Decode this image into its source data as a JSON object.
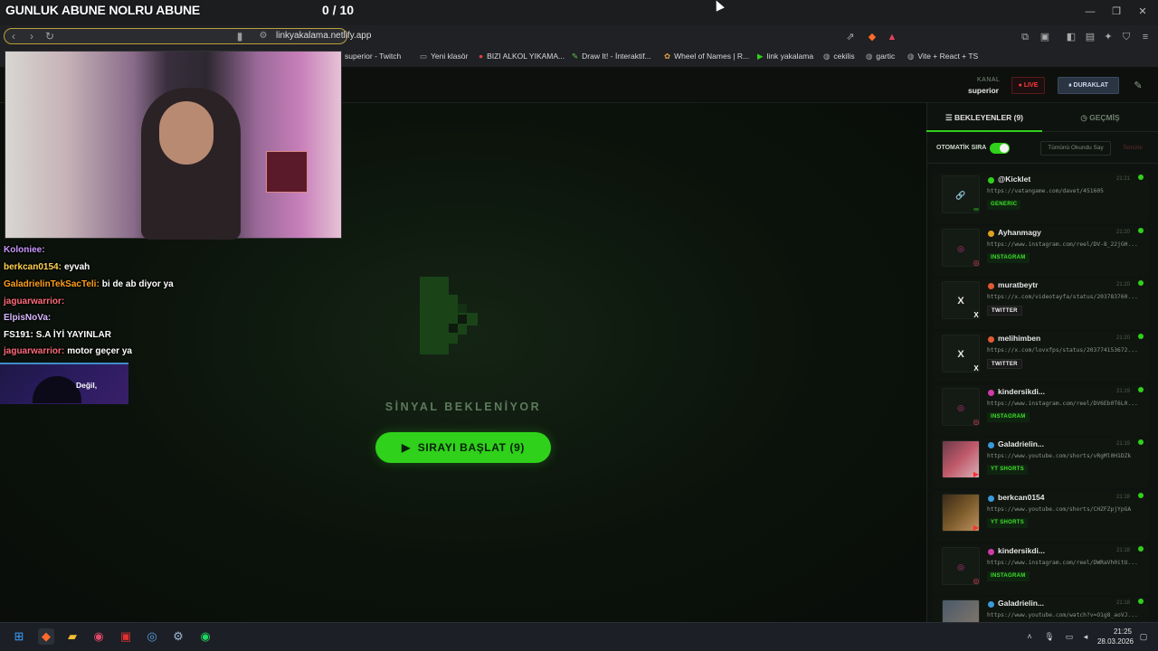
{
  "stream_overlay": {
    "title": "GUNLUK ABUNE NOLRU ABUNE",
    "counter": "0 / 10"
  },
  "browser": {
    "url": "linkyakalama.netlify.app",
    "bookmarks": [
      {
        "label": "superior - Twitch",
        "icon": "twitch-icon"
      },
      {
        "label": "Yeni klasör",
        "icon": "folder-icon"
      },
      {
        "label": "BIZI ALKOL YIKAMA...",
        "icon": "bookmark-icon"
      },
      {
        "label": "Draw It! - İnteraktif...",
        "icon": "draw-icon"
      },
      {
        "label": "Wheel of Names | R...",
        "icon": "wheel-icon"
      },
      {
        "label": "link yakalama",
        "icon": "play-icon"
      },
      {
        "label": "cekilis",
        "icon": "globe-icon"
      },
      {
        "label": "gartic",
        "icon": "globe-icon"
      },
      {
        "label": "Vite + React + TS",
        "icon": "globe-icon"
      }
    ]
  },
  "header": {
    "kanal_label": "KANAL",
    "kanal_name": "superior",
    "live_label": "LIVE",
    "pause_label": "DURAKLAT"
  },
  "main": {
    "status": "SİNYAL BEKLENİYOR",
    "start_button": "SIRAYI BAŞLAT (9)"
  },
  "chat": [
    {
      "user": "Koloniee:",
      "color": "#c995ff",
      "msg": ""
    },
    {
      "user": "berkcan0154:",
      "color": "#ffd34d",
      "msg": "eyvah"
    },
    {
      "user": "GaladrielinTekSacTeli:",
      "color": "#ff9f1c",
      "msg": "bi de ab diyor ya"
    },
    {
      "user": "jaguarwarrior:",
      "color": "#ff6a7a",
      "msg": ""
    },
    {
      "user": "ElpisNoVa:",
      "color": "#d9b8ff",
      "msg": ""
    },
    {
      "user": "FS191:",
      "color": "#ffffff",
      "msg": "S.A İYİ YAYINLAR"
    },
    {
      "user": "jaguarwarrior:",
      "color": "#ff6a7a",
      "msg": "motor geçer ya"
    }
  ],
  "chat_notification": "Değil,",
  "sidebar": {
    "tab_queue": "BEKLEYENLER (9)",
    "tab_history": "GEÇMİŞ",
    "auto_label": "OTOMATİK SIRA",
    "mark_all": "Tümünü Okundu Say",
    "clear": "Temizle",
    "items": [
      {
        "name": "@Kicklet",
        "time": "21:21",
        "url": "https://vatangame.com/davet/451605",
        "tag": "GENERIC",
        "src_color": "#2fd11a",
        "thumb": "link-icon"
      },
      {
        "name": "Ayhanmagy",
        "time": "21:20",
        "url": "https://www.instagram.com/reel/DV-8_22jGH...",
        "tag": "INSTAGRAM",
        "src_color": "#e0a020",
        "thumb": "instagram-icon"
      },
      {
        "name": "muratbeytr",
        "time": "21:20",
        "url": "https://x.com/videotayfa/status/203783760...",
        "tag": "TWITTER",
        "src_color": "#e05a30",
        "thumb": "x-icon"
      },
      {
        "name": "melihimben",
        "time": "21:20",
        "url": "https://x.com/lovxfps/status/203774153672...",
        "tag": "TWITTER",
        "src_color": "#e05a30",
        "thumb": "x-icon"
      },
      {
        "name": "kindersikdi...",
        "time": "21:19",
        "url": "https://www.instagram.com/reel/DV6Eb0T6L0...",
        "tag": "INSTAGRAM",
        "src_color": "#d03aa8",
        "thumb": "instagram-icon"
      },
      {
        "name": "Galadrielin...",
        "time": "21:19",
        "url": "https://www.youtube.com/shorts/vRgMl0H1DZk",
        "tag": "YT SHORTS",
        "src_color": "#3a9ad9",
        "thumb": "video-thumbnail"
      },
      {
        "name": "berkcan0154",
        "time": "21:18",
        "url": "https://www.youtube.com/shorts/CHZFZpjYpGA",
        "tag": "YT SHORTS",
        "src_color": "#3a9ad9",
        "thumb": "video-thumbnail"
      },
      {
        "name": "kindersikdi...",
        "time": "21:18",
        "url": "https://www.instagram.com/reel/DWRaVh0itU...",
        "tag": "INSTAGRAM",
        "src_color": "#d03aa8",
        "thumb": "instagram-icon"
      },
      {
        "name": "Galadrielin...",
        "time": "21:18",
        "url": "https://www.youtube.com/watch?v=O1g8_aoVJ...",
        "tag": "",
        "src_color": "#3a9ad9",
        "thumb": "video-thumbnail"
      }
    ]
  },
  "taskbar": {
    "time": "21:25",
    "date": "28.03.2026"
  }
}
